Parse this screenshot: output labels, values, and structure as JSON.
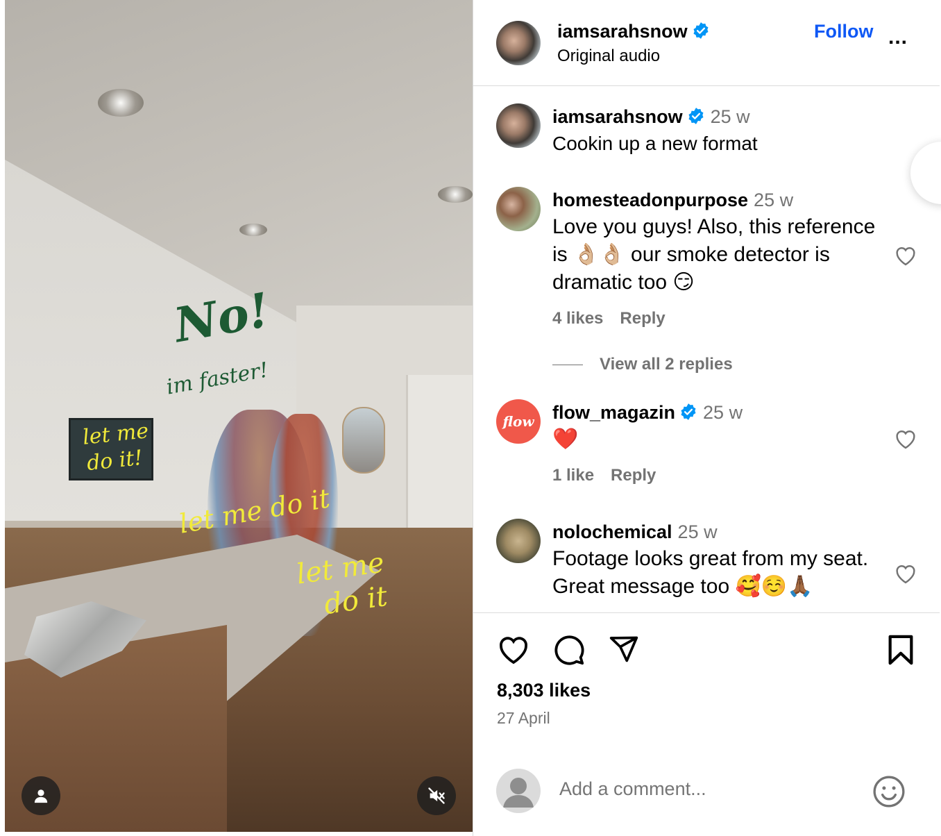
{
  "video": {
    "overlay_texts": {
      "no": "No!",
      "faster": "im faster!",
      "let_me_1a": "let me",
      "let_me_1b": "do it!",
      "let_me_2": "let me do it",
      "let_me_3a": "let me",
      "let_me_3b": "do it"
    },
    "icons": {
      "tag": "person-icon",
      "mute": "muted-speaker-icon"
    }
  },
  "header": {
    "username": "iamsarahsnow",
    "audio": "Original audio",
    "follow_label": "Follow",
    "more_label": "..."
  },
  "caption": {
    "username": "iamsarahsnow",
    "time": "25 w",
    "text": "Cookin up a new format"
  },
  "comments": [
    {
      "username": "homesteadonpurpose",
      "time": "25 w",
      "text": "Love you guys! Also, this reference is 👌🏼👌🏼 our smoke detector is dramatic too 😏",
      "likes": "4 likes",
      "reply": "Reply",
      "view_replies": "View all 2 replies"
    },
    {
      "username": "flow_magazin",
      "avatar_text": "flow",
      "time": "25 w",
      "text": "❤️",
      "likes": "1 like",
      "reply": "Reply"
    },
    {
      "username": "nolochemical",
      "time": "25 w",
      "text": "Footage looks great from my seat. Great message too 🥰☺️🙏🏾"
    }
  ],
  "actions": {
    "likes": "8,303 likes",
    "date": "27 April",
    "icons": [
      "heart-icon",
      "comment-icon",
      "share-icon",
      "bookmark-icon"
    ]
  },
  "add_comment": {
    "placeholder": "Add a comment..."
  },
  "colors": {
    "accent": "#0f58f5",
    "verified": "#0095f6",
    "muted": "#737373"
  }
}
